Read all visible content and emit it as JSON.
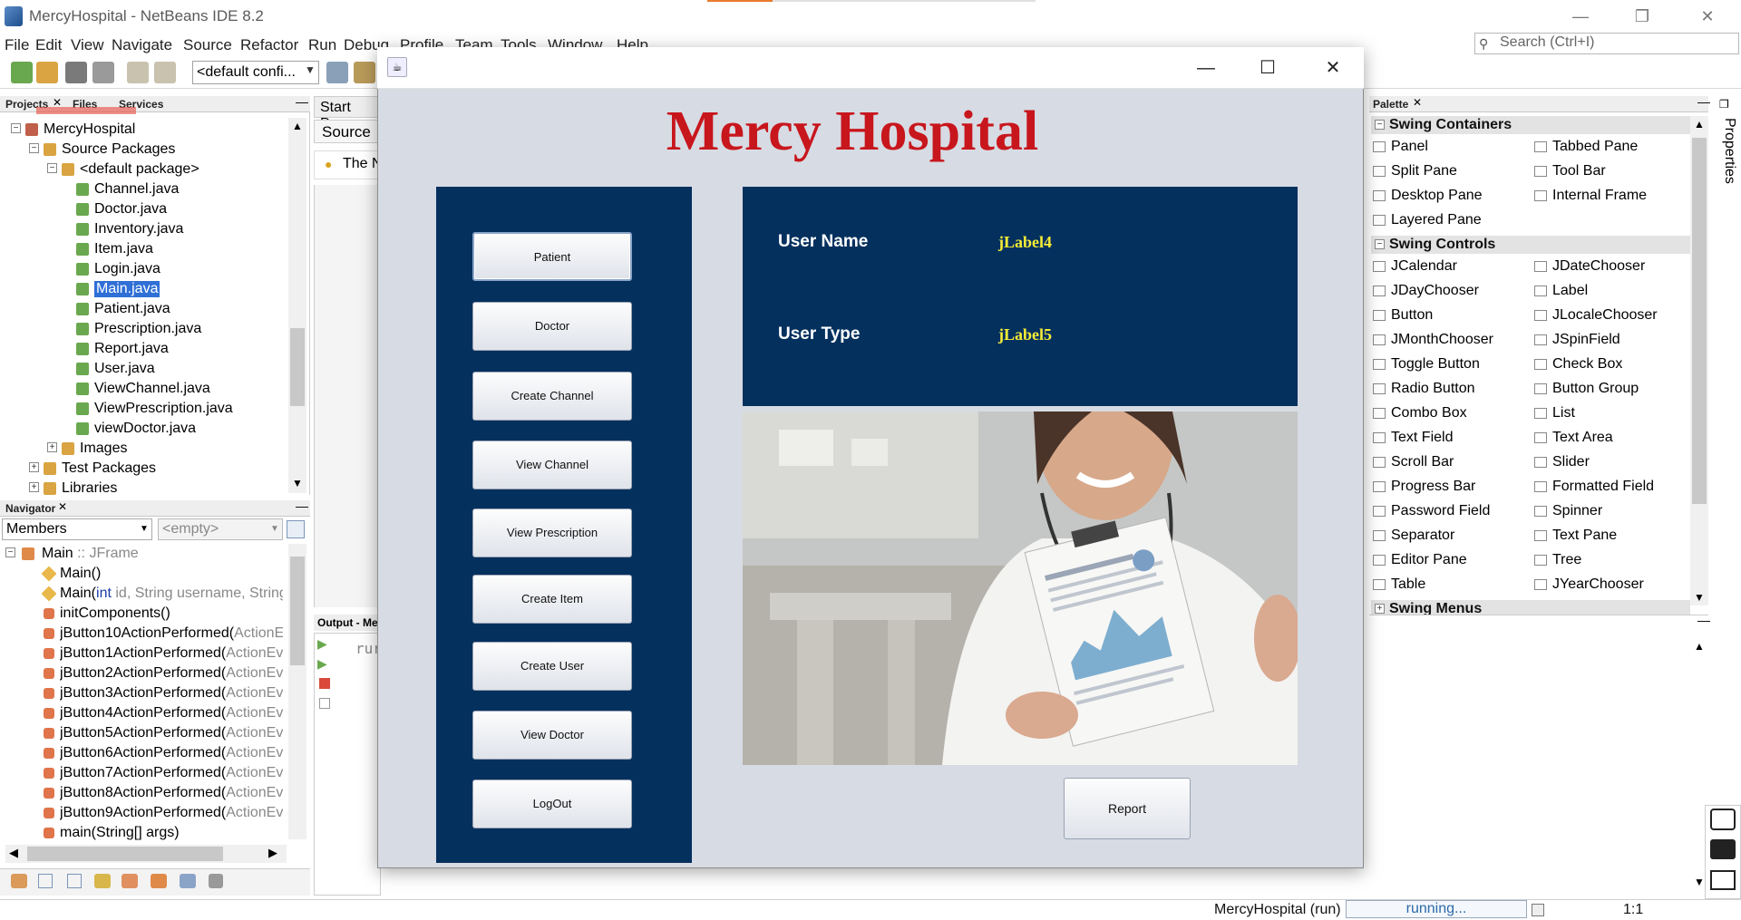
{
  "window": {
    "title": "MercyHospital - NetBeans IDE 8.2",
    "controls": [
      "—",
      "❐",
      "✕"
    ]
  },
  "menu": [
    "File",
    "Edit",
    "View",
    "Navigate",
    "Source",
    "Refactor",
    "Run",
    "Debug",
    "Profile",
    "Team",
    "Tools",
    "Window",
    "Help"
  ],
  "search": {
    "placeholder": "Search (Ctrl+I)"
  },
  "toolbar": {
    "config_value": "<default confi..."
  },
  "projects_panel": {
    "tabs": [
      "Projects",
      "Files",
      "Services"
    ],
    "tree": [
      {
        "label": "MercyHospital",
        "level": 0
      },
      {
        "label": "Source Packages",
        "level": 1
      },
      {
        "label": "<default package>",
        "level": 2
      },
      {
        "label": "Channel.java",
        "level": 3
      },
      {
        "label": "Doctor.java",
        "level": 3
      },
      {
        "label": "Inventory.java",
        "level": 3
      },
      {
        "label": "Item.java",
        "level": 3
      },
      {
        "label": "Login.java",
        "level": 3
      },
      {
        "label": "Main.java",
        "level": 3,
        "selected": true
      },
      {
        "label": "Patient.java",
        "level": 3
      },
      {
        "label": "Prescription.java",
        "level": 3
      },
      {
        "label": "Report.java",
        "level": 3
      },
      {
        "label": "User.java",
        "level": 3
      },
      {
        "label": "ViewChannel.java",
        "level": 3
      },
      {
        "label": "ViewPrescription.java",
        "level": 3
      },
      {
        "label": "viewDoctor.java",
        "level": 3
      },
      {
        "label": "Images",
        "level": 2
      },
      {
        "label": "Test Packages",
        "level": 1
      },
      {
        "label": "Libraries",
        "level": 1
      }
    ]
  },
  "navigator_panel": {
    "title": "Navigator",
    "filter_value": "Members",
    "empty_value": "<empty>",
    "items": [
      {
        "name": "Main",
        "rest": " :: JFrame",
        "level": 0
      },
      {
        "name": "Main()",
        "rest": "",
        "level": 1
      },
      {
        "name": "Main(",
        "rest_dark": "int",
        "rest": " id, String username, String",
        "level": 1
      },
      {
        "name": "initComponents()",
        "rest": "",
        "level": 1
      },
      {
        "name": "jButton10ActionPerformed(",
        "rest": "ActionE",
        "level": 1
      },
      {
        "name": "jButton1ActionPerformed(",
        "rest": "ActionEv",
        "level": 1
      },
      {
        "name": "jButton2ActionPerformed(",
        "rest": "ActionEv",
        "level": 1
      },
      {
        "name": "jButton3ActionPerformed(",
        "rest": "ActionEv",
        "level": 1
      },
      {
        "name": "jButton4ActionPerformed(",
        "rest": "ActionEv",
        "level": 1
      },
      {
        "name": "jButton5ActionPerformed(",
        "rest": "ActionEv",
        "level": 1
      },
      {
        "name": "jButton6ActionPerformed(",
        "rest": "ActionEv",
        "level": 1
      },
      {
        "name": "jButton7ActionPerformed(",
        "rest": "ActionEv",
        "level": 1
      },
      {
        "name": "jButton8ActionPerformed(",
        "rest": "ActionEv",
        "level": 1
      },
      {
        "name": "jButton9ActionPerformed(",
        "rest": "ActionEv",
        "level": 1
      },
      {
        "name": "main(String[] args)",
        "rest": "",
        "level": 1
      }
    ]
  },
  "editor": {
    "tab": "Start Pag",
    "source_tab": "Source",
    "hint": "The N",
    "output_tab": "Output - Me",
    "output_text": "rur"
  },
  "palette": {
    "title": "Palette",
    "categories": [
      {
        "name": "Swing Containers",
        "items": [
          [
            "Panel",
            "Tabbed Pane"
          ],
          [
            "Split Pane",
            "Tool Bar"
          ],
          [
            "Desktop Pane",
            "Internal Frame"
          ],
          [
            "Layered Pane",
            ""
          ]
        ]
      },
      {
        "name": "Swing Controls",
        "items": [
          [
            "JCalendar",
            "JDateChooser"
          ],
          [
            "JDayChooser",
            "Label"
          ],
          [
            "Button",
            "JLocaleChooser"
          ],
          [
            "JMonthChooser",
            "JSpinField"
          ],
          [
            "Toggle Button",
            "Check Box"
          ],
          [
            "Radio Button",
            "Button Group"
          ],
          [
            "Combo Box",
            "List"
          ],
          [
            "Text Field",
            "Text Area"
          ],
          [
            "Scroll Bar",
            "Slider"
          ],
          [
            "Progress Bar",
            "Formatted Field"
          ],
          [
            "Password Field",
            "Spinner"
          ],
          [
            "Separator",
            "Text Pane"
          ],
          [
            "Editor Pane",
            "Tree"
          ],
          [
            "Table",
            "JYearChooser"
          ]
        ]
      },
      {
        "name": "Swing Menus",
        "items": []
      }
    ],
    "properties_tab": "Properties"
  },
  "app": {
    "title": "Mercy Hospital",
    "buttons": [
      "Patient",
      "Doctor",
      "Create Channel",
      "View Channel",
      "View Prescription",
      "Create Item",
      "Create User",
      "View Doctor",
      "LogOut"
    ],
    "info": {
      "user_name_label": "User Name",
      "user_name_value": "jLabel4",
      "user_type_label": "User Type",
      "user_type_value": "jLabel5"
    },
    "report_button": "Report",
    "colors": {
      "panel": "#04305e",
      "title": "#c8161d",
      "value": "#f5ec37"
    }
  },
  "statusbar": {
    "project": "MercyHospital (run)",
    "progress": "running...",
    "position": "1:1"
  }
}
